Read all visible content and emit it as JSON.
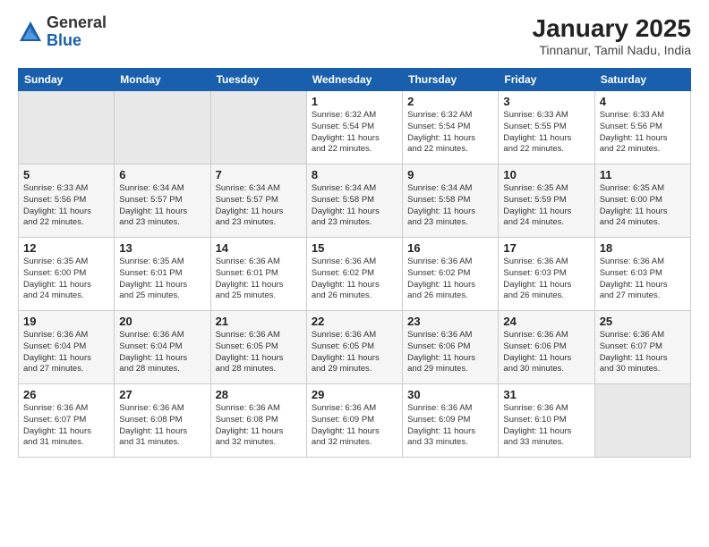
{
  "header": {
    "logo_general": "General",
    "logo_blue": "Blue",
    "month_year": "January 2025",
    "location": "Tinnanur, Tamil Nadu, India"
  },
  "days_of_week": [
    "Sunday",
    "Monday",
    "Tuesday",
    "Wednesday",
    "Thursday",
    "Friday",
    "Saturday"
  ],
  "weeks": [
    [
      {
        "day": "",
        "info": ""
      },
      {
        "day": "",
        "info": ""
      },
      {
        "day": "",
        "info": ""
      },
      {
        "day": "1",
        "info": "Sunrise: 6:32 AM\nSunset: 5:54 PM\nDaylight: 11 hours\nand 22 minutes."
      },
      {
        "day": "2",
        "info": "Sunrise: 6:32 AM\nSunset: 5:54 PM\nDaylight: 11 hours\nand 22 minutes."
      },
      {
        "day": "3",
        "info": "Sunrise: 6:33 AM\nSunset: 5:55 PM\nDaylight: 11 hours\nand 22 minutes."
      },
      {
        "day": "4",
        "info": "Sunrise: 6:33 AM\nSunset: 5:56 PM\nDaylight: 11 hours\nand 22 minutes."
      }
    ],
    [
      {
        "day": "5",
        "info": "Sunrise: 6:33 AM\nSunset: 5:56 PM\nDaylight: 11 hours\nand 22 minutes."
      },
      {
        "day": "6",
        "info": "Sunrise: 6:34 AM\nSunset: 5:57 PM\nDaylight: 11 hours\nand 23 minutes."
      },
      {
        "day": "7",
        "info": "Sunrise: 6:34 AM\nSunset: 5:57 PM\nDaylight: 11 hours\nand 23 minutes."
      },
      {
        "day": "8",
        "info": "Sunrise: 6:34 AM\nSunset: 5:58 PM\nDaylight: 11 hours\nand 23 minutes."
      },
      {
        "day": "9",
        "info": "Sunrise: 6:34 AM\nSunset: 5:58 PM\nDaylight: 11 hours\nand 23 minutes."
      },
      {
        "day": "10",
        "info": "Sunrise: 6:35 AM\nSunset: 5:59 PM\nDaylight: 11 hours\nand 24 minutes."
      },
      {
        "day": "11",
        "info": "Sunrise: 6:35 AM\nSunset: 6:00 PM\nDaylight: 11 hours\nand 24 minutes."
      }
    ],
    [
      {
        "day": "12",
        "info": "Sunrise: 6:35 AM\nSunset: 6:00 PM\nDaylight: 11 hours\nand 24 minutes."
      },
      {
        "day": "13",
        "info": "Sunrise: 6:35 AM\nSunset: 6:01 PM\nDaylight: 11 hours\nand 25 minutes."
      },
      {
        "day": "14",
        "info": "Sunrise: 6:36 AM\nSunset: 6:01 PM\nDaylight: 11 hours\nand 25 minutes."
      },
      {
        "day": "15",
        "info": "Sunrise: 6:36 AM\nSunset: 6:02 PM\nDaylight: 11 hours\nand 26 minutes."
      },
      {
        "day": "16",
        "info": "Sunrise: 6:36 AM\nSunset: 6:02 PM\nDaylight: 11 hours\nand 26 minutes."
      },
      {
        "day": "17",
        "info": "Sunrise: 6:36 AM\nSunset: 6:03 PM\nDaylight: 11 hours\nand 26 minutes."
      },
      {
        "day": "18",
        "info": "Sunrise: 6:36 AM\nSunset: 6:03 PM\nDaylight: 11 hours\nand 27 minutes."
      }
    ],
    [
      {
        "day": "19",
        "info": "Sunrise: 6:36 AM\nSunset: 6:04 PM\nDaylight: 11 hours\nand 27 minutes."
      },
      {
        "day": "20",
        "info": "Sunrise: 6:36 AM\nSunset: 6:04 PM\nDaylight: 11 hours\nand 28 minutes."
      },
      {
        "day": "21",
        "info": "Sunrise: 6:36 AM\nSunset: 6:05 PM\nDaylight: 11 hours\nand 28 minutes."
      },
      {
        "day": "22",
        "info": "Sunrise: 6:36 AM\nSunset: 6:05 PM\nDaylight: 11 hours\nand 29 minutes."
      },
      {
        "day": "23",
        "info": "Sunrise: 6:36 AM\nSunset: 6:06 PM\nDaylight: 11 hours\nand 29 minutes."
      },
      {
        "day": "24",
        "info": "Sunrise: 6:36 AM\nSunset: 6:06 PM\nDaylight: 11 hours\nand 30 minutes."
      },
      {
        "day": "25",
        "info": "Sunrise: 6:36 AM\nSunset: 6:07 PM\nDaylight: 11 hours\nand 30 minutes."
      }
    ],
    [
      {
        "day": "26",
        "info": "Sunrise: 6:36 AM\nSunset: 6:07 PM\nDaylight: 11 hours\nand 31 minutes."
      },
      {
        "day": "27",
        "info": "Sunrise: 6:36 AM\nSunset: 6:08 PM\nDaylight: 11 hours\nand 31 minutes."
      },
      {
        "day": "28",
        "info": "Sunrise: 6:36 AM\nSunset: 6:08 PM\nDaylight: 11 hours\nand 32 minutes."
      },
      {
        "day": "29",
        "info": "Sunrise: 6:36 AM\nSunset: 6:09 PM\nDaylight: 11 hours\nand 32 minutes."
      },
      {
        "day": "30",
        "info": "Sunrise: 6:36 AM\nSunset: 6:09 PM\nDaylight: 11 hours\nand 33 minutes."
      },
      {
        "day": "31",
        "info": "Sunrise: 6:36 AM\nSunset: 6:10 PM\nDaylight: 11 hours\nand 33 minutes."
      },
      {
        "day": "",
        "info": ""
      }
    ]
  ]
}
